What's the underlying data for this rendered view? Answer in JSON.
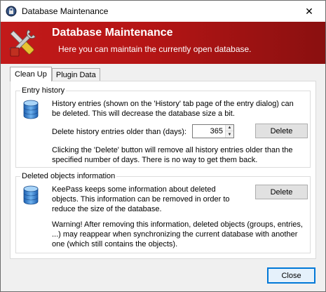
{
  "window": {
    "title": "Database Maintenance",
    "close_glyph": "✕"
  },
  "banner": {
    "title": "Database Maintenance",
    "subtitle": "Here you can maintain the currently open database.",
    "icon": "tools-icon"
  },
  "tabs": [
    {
      "label": "Clean Up",
      "active": true
    },
    {
      "label": "Plugin Data",
      "active": false
    }
  ],
  "entry_history": {
    "group_label": "Entry history",
    "description": "History entries (shown on the 'History' tab page of the entry dialog) can be deleted. This will decrease the database size a bit.",
    "days_label": "Delete history entries older than (days):",
    "days_value": "365",
    "delete_label": "Delete",
    "note": "Clicking the 'Delete' button will remove all history entries older than the specified number of days. There is no way to get them back."
  },
  "deleted_objects": {
    "group_label": "Deleted objects information",
    "description": "KeePass keeps some information about deleted objects. This information can be removed in order to reduce the size of the database.",
    "delete_label": "Delete",
    "warning": "Warning! After removing this information, deleted objects (groups, entries, ...) may reappear when synchronizing the current database with another one (which still contains the objects)."
  },
  "footer": {
    "close_label": "Close"
  },
  "colors": {
    "banner": "#c21a1a",
    "accent": "#0078d7"
  }
}
